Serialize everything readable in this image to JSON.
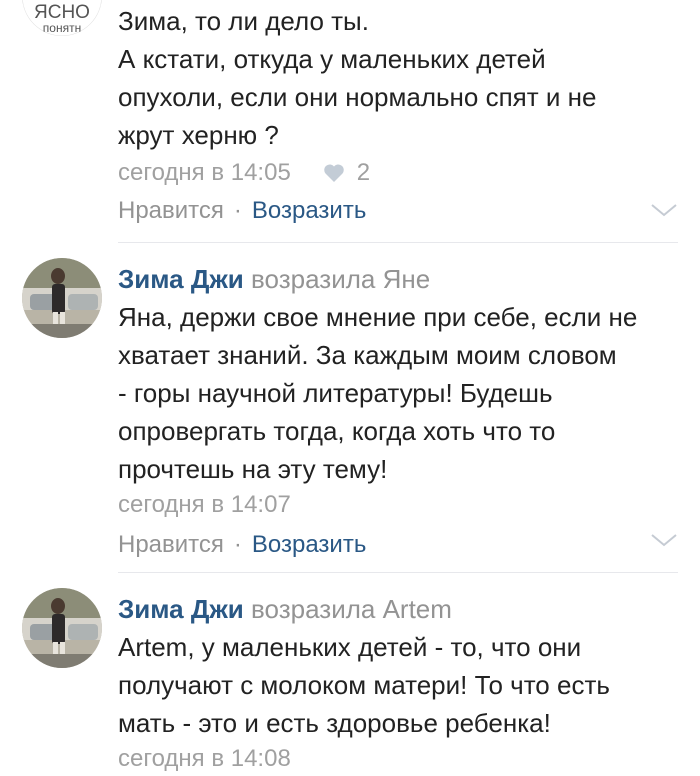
{
  "comments": [
    {
      "avatar_text": [
        "ЯСНО",
        "понятн"
      ],
      "lines": [
        "Зима, то ли дело ты.",
        "А кстати, откуда у маленьких детей",
        "опухоли, если они нормально спят и не",
        "жрут херню ?"
      ],
      "time": "сегодня в 14:05",
      "likes": "2",
      "like_label": "Нравится",
      "separator": "·",
      "reply_label": "Возразить"
    },
    {
      "author": "Зима Джи",
      "action": "возразила Яне",
      "lines": [
        "Яна, держи свое мнение при себе, если не",
        "хватает знаний. За каждым моим словом",
        "- горы научной литературы! Будешь",
        "опровергать тогда, когда хоть что то",
        "прочтешь на эту тему!"
      ],
      "time": "сегодня в 14:07",
      "like_label": "Нравится",
      "separator": "·",
      "reply_label": "Возразить"
    },
    {
      "author": "Зима Джи",
      "action": "возразила Artem",
      "lines": [
        "Artem, у маленьких детей - то, что они",
        "получают с молоком матери! То что есть",
        "мать - это и есть здоровье ребенка!"
      ],
      "time": "сегодня в 14:08"
    }
  ],
  "colors": {
    "link": "#2a5885",
    "muted": "#a0a0a0",
    "text": "#222222"
  }
}
